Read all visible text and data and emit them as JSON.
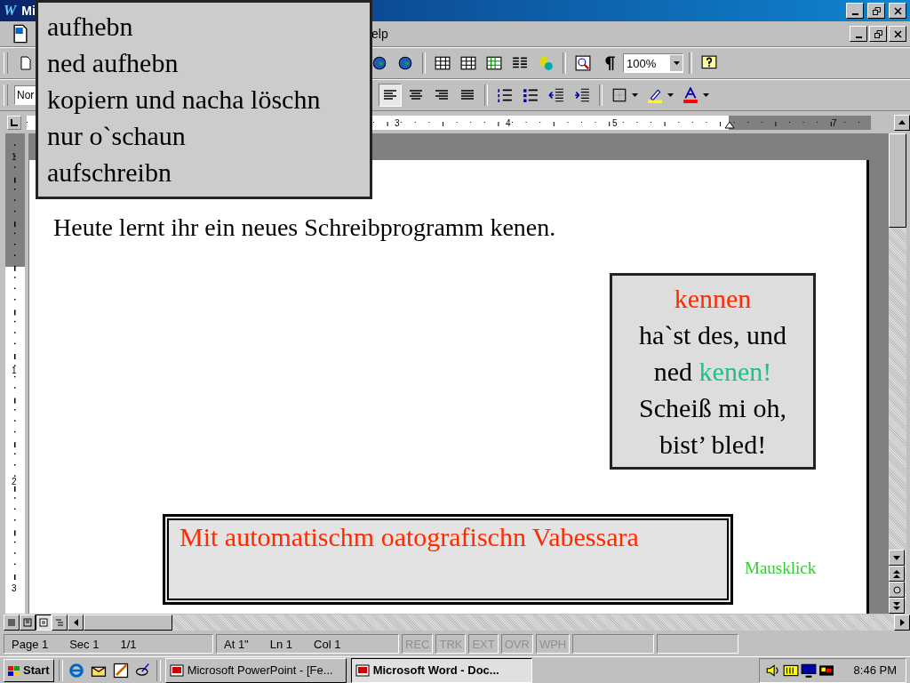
{
  "window": {
    "logo": "W",
    "title": "Mi"
  },
  "menu_bar": {
    "items": [
      "elp"
    ]
  },
  "formatting": {
    "style": "Nor",
    "zoom": "100%",
    "alignments": [
      {
        "kind": "left",
        "selected": true
      },
      {
        "kind": "center",
        "selected": false
      },
      {
        "kind": "right",
        "selected": false
      },
      {
        "kind": "justify",
        "selected": false
      }
    ]
  },
  "ruler": {
    "horizontal_labels": [
      "3",
      "4",
      "5",
      "7"
    ],
    "vertical_labels": [
      "1",
      "1",
      "2",
      "3"
    ]
  },
  "popup_menu": {
    "items": [
      "aufhebn",
      "ned aufhebn",
      "kopiern und nacha löschn",
      "nur o`schaun",
      "aufschreibn"
    ]
  },
  "document": {
    "text": "Heute lernt ihr ein neues Schreibprogramm kenen.",
    "callout": {
      "lines": [
        [
          {
            "text": "kennen",
            "color": "#ff2a00"
          }
        ],
        [
          {
            "text": "ha`st des, und",
            "color": "#000000"
          }
        ],
        [
          {
            "text": "ned ",
            "color": "#000000"
          },
          {
            "text": "kenen!",
            "color": "#1dc28a"
          }
        ],
        [
          {
            "text": "Scheiß mi oh,",
            "color": "#000000"
          }
        ],
        [
          {
            "text": "bist’ bled!",
            "color": "#000000"
          }
        ]
      ]
    },
    "spell_box": {
      "text": "Mit automatischm oatografischn Vabessara"
    },
    "hint": "Mausklick"
  },
  "status_bar": {
    "fields": [
      "Page 1",
      "Sec 1",
      "1/1",
      "At 1\"",
      "Ln 1",
      "Col 1"
    ],
    "modes": [
      {
        "label": "REC",
        "disabled": true
      },
      {
        "label": "TRK",
        "disabled": true
      },
      {
        "label": "EXT",
        "disabled": true
      },
      {
        "label": "OVR",
        "disabled": true
      },
      {
        "label": "WPH",
        "disabled": true
      }
    ]
  },
  "taskbar": {
    "start": "Start",
    "tasks": [
      {
        "label": "Microsoft PowerPoint - [Fe...",
        "selected": false
      },
      {
        "label": "Microsoft Word - Doc...",
        "selected": true
      }
    ],
    "clock": "8:46 PM"
  }
}
